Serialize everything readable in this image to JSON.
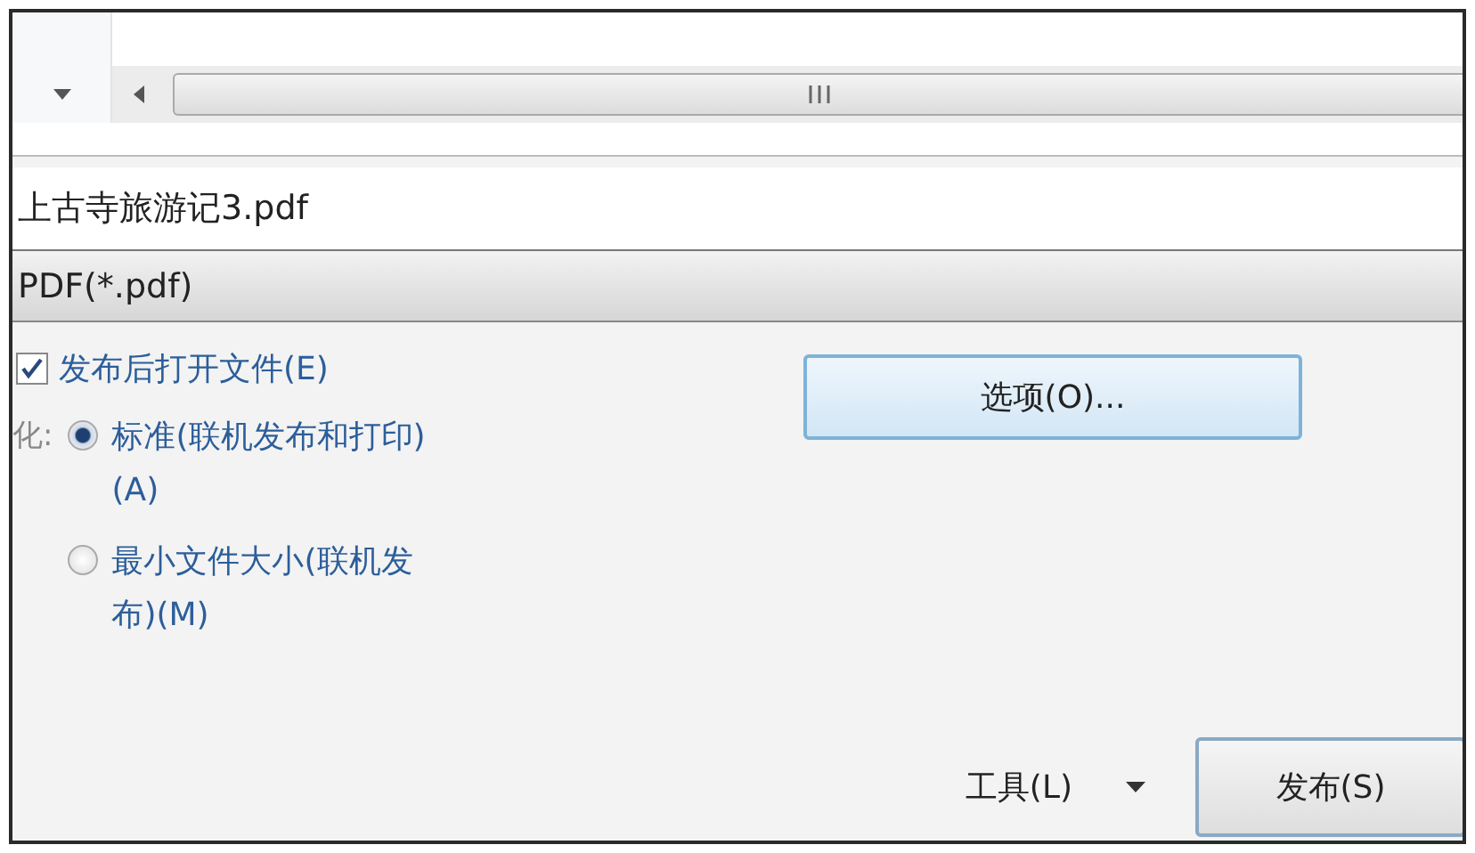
{
  "file_name": {
    "value": "上古寺旅游记3.pdf"
  },
  "file_type": {
    "value": "PDF(*.pdf)"
  },
  "open_after_publish": {
    "label": "发布后打开文件(E)",
    "checked": true
  },
  "options_button": "选项(O)...",
  "optimize": {
    "label": "化:",
    "options": [
      {
        "label": "标准(联机发布和打印)(A)",
        "selected": true
      },
      {
        "label": "最小文件大小(联机发布)(M)",
        "selected": false
      }
    ]
  },
  "tools": {
    "label": "工具(L)"
  },
  "publish_button": "发布(S)"
}
